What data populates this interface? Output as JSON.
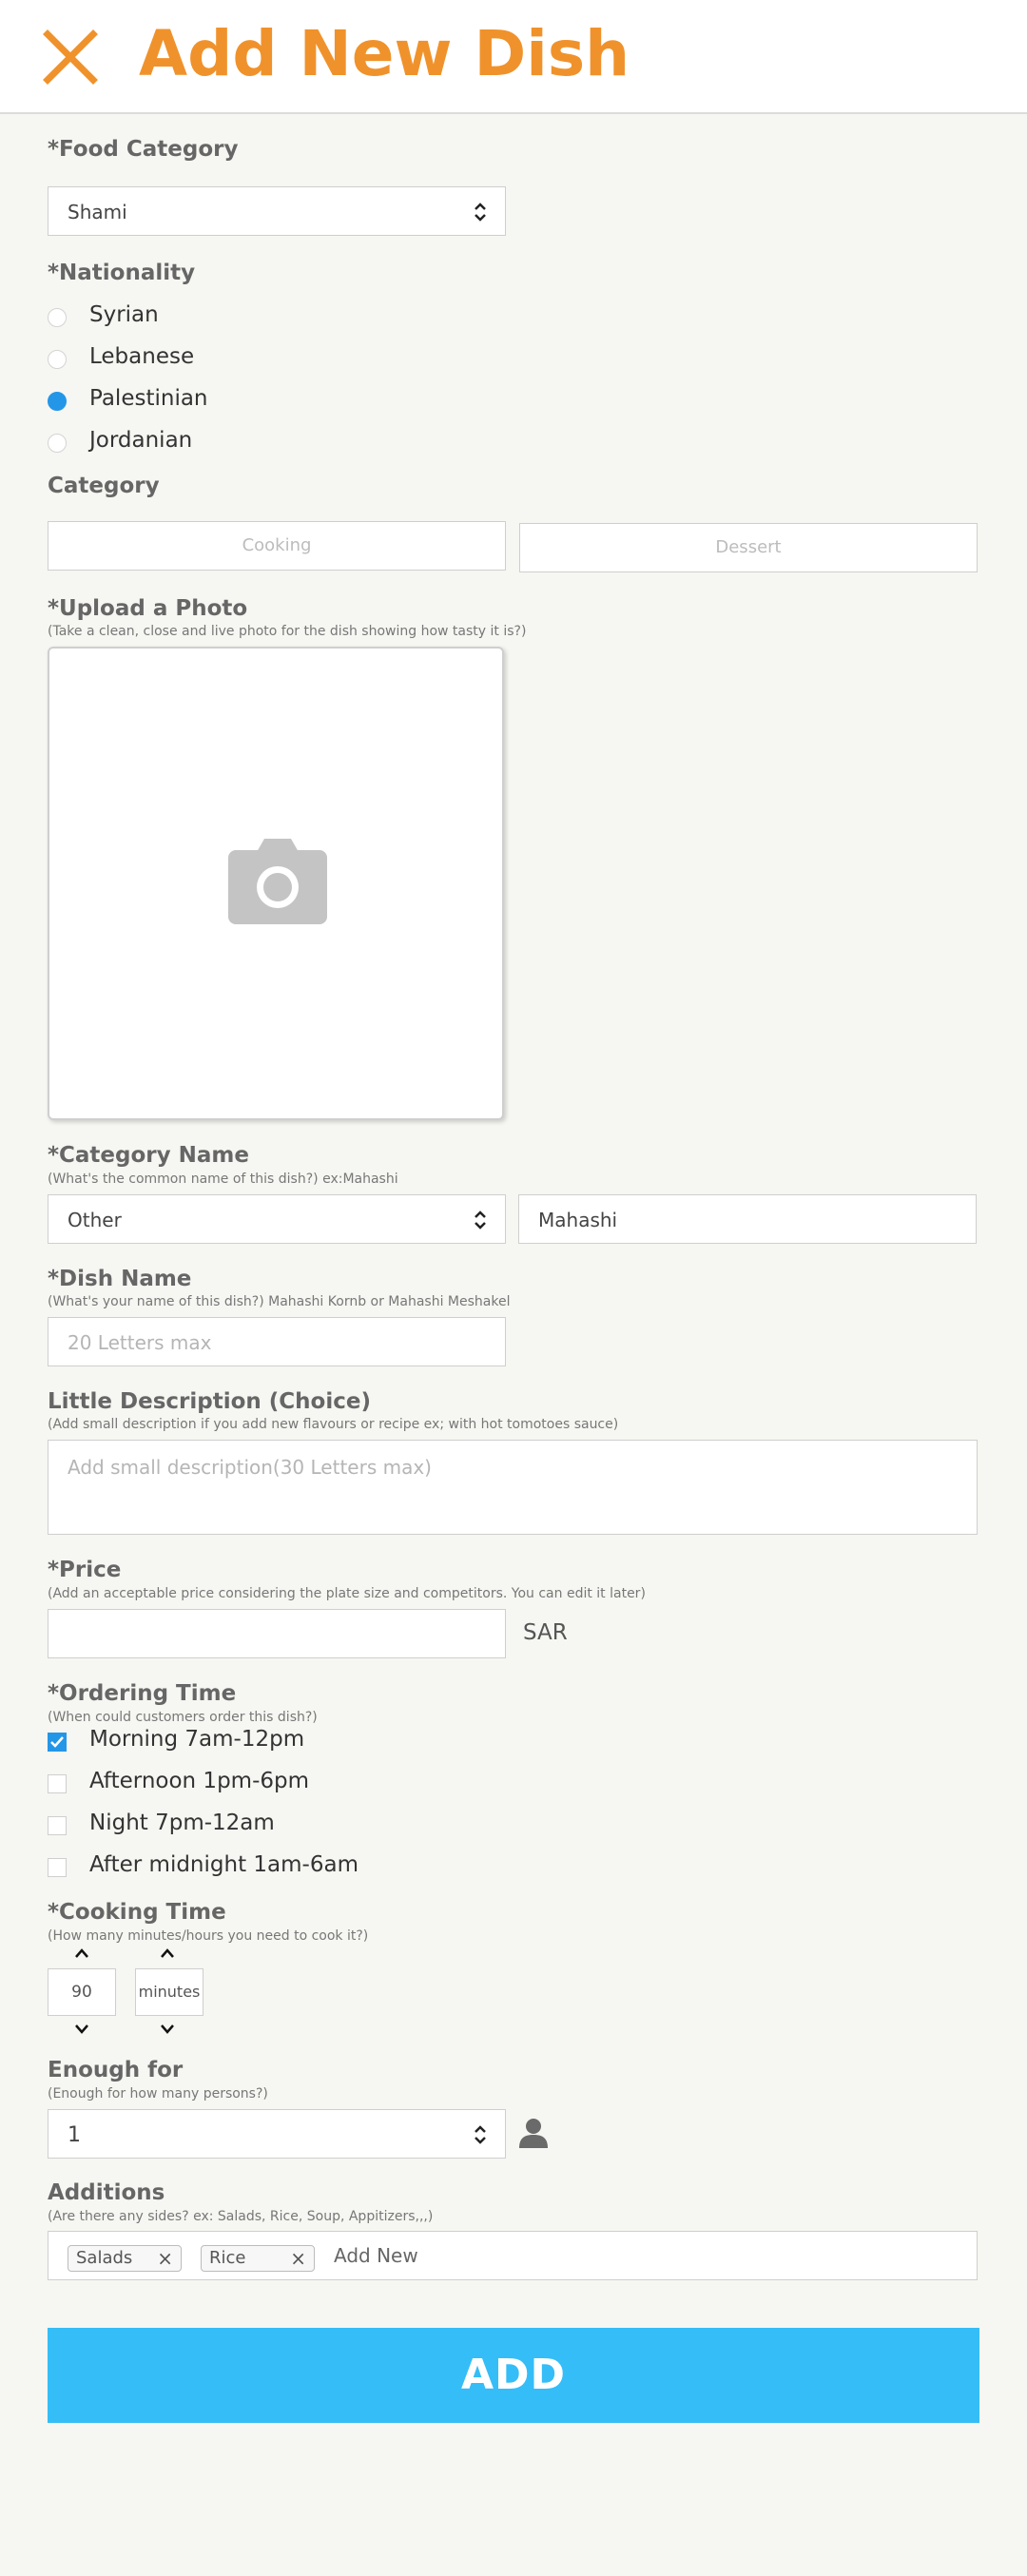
{
  "header": {
    "title": "Add New Dish",
    "close_icon": "close-icon",
    "accent": "#f0922b"
  },
  "food_category": {
    "label": "*Food Category",
    "value": "Shami"
  },
  "nationality": {
    "label": "*Nationality",
    "options": [
      "Syrian",
      "Lebanese",
      "Palestinian",
      "Jordanian"
    ],
    "selected": "Palestinian"
  },
  "category": {
    "label": "Category",
    "buttons": [
      "Cooking",
      "Dessert"
    ]
  },
  "photo": {
    "label": "*Upload a Photo",
    "hint": "(Take a clean, close and live photo for the dish showing how tasty it is?)",
    "icon": "camera-icon"
  },
  "category_name": {
    "label": "*Category Name",
    "hint": "(What's the common name of this dish?) ex:Mahashi",
    "select_value": "Other",
    "input_value": "Mahashi"
  },
  "dish_name": {
    "label": "*Dish Name",
    "hint": "(What's your name of this dish?) Mahashi Kornb or Mahashi Meshakel",
    "placeholder": "20 Letters max"
  },
  "description": {
    "label": "Little Description (Choice)",
    "hint": "(Add small description if you add new flavours or recipe ex; with hot tomotoes sauce)",
    "placeholder": "Add small description(30 Letters max)"
  },
  "price": {
    "label": "*Price",
    "hint": "(Add an acceptable price considering the plate size  and competitors. You can edit it later)",
    "value": "",
    "currency": "SAR"
  },
  "ordering_time": {
    "label": "*Ordering Time",
    "hint": "(When could customers order this dish?)",
    "options": [
      {
        "label": "Morning 7am-12pm",
        "checked": true
      },
      {
        "label": "Afternoon 1pm-6pm",
        "checked": false
      },
      {
        "label": "Night 7pm-12am",
        "checked": false
      },
      {
        "label": "After midnight 1am-6am",
        "checked": false
      }
    ]
  },
  "cooking_time": {
    "label": "*Cooking Time",
    "hint": "(How many minutes/hours you need to cook it?)",
    "value": "90",
    "unit": "minutes"
  },
  "enough_for": {
    "label": "Enough for",
    "hint": "(Enough for how many persons?)",
    "value": "1",
    "icon": "person-icon"
  },
  "additions": {
    "label": "Additions",
    "hint": "(Are there any sides? ex: Salads, Rice, Soup, Appitizers,,,)",
    "tags": [
      "Salads",
      "Rice"
    ],
    "add_new": "Add New"
  },
  "submit": {
    "label": "ADD",
    "color": "#35bdf7"
  }
}
